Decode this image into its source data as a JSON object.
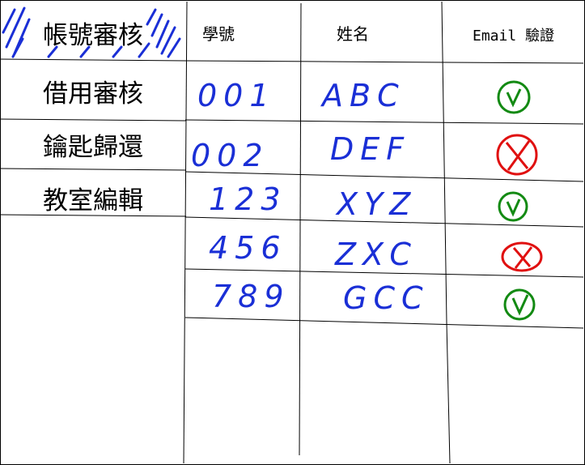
{
  "sidebar": {
    "items": [
      {
        "label": "帳號審核",
        "active": true
      },
      {
        "label": "借用審核"
      },
      {
        "label": "鑰匙歸還"
      },
      {
        "label": "教室編輯"
      }
    ]
  },
  "table": {
    "headers": [
      "學號",
      "姓名",
      "Email 驗證"
    ],
    "rows": [
      {
        "id": "001",
        "name": "ABC",
        "email_verified": true
      },
      {
        "id": "002",
        "name": "DEF",
        "email_verified": false
      },
      {
        "id": "123",
        "name": "XYZ",
        "email_verified": true
      },
      {
        "id": "456",
        "name": "ZXC",
        "email_verified": false
      },
      {
        "id": "789",
        "name": "GCC",
        "email_verified": true
      }
    ]
  },
  "colors": {
    "verified": "#138a13",
    "rejected": "#e01010",
    "handwriting": "#1a2fd6",
    "active_hatch": "#1a2fd6"
  }
}
